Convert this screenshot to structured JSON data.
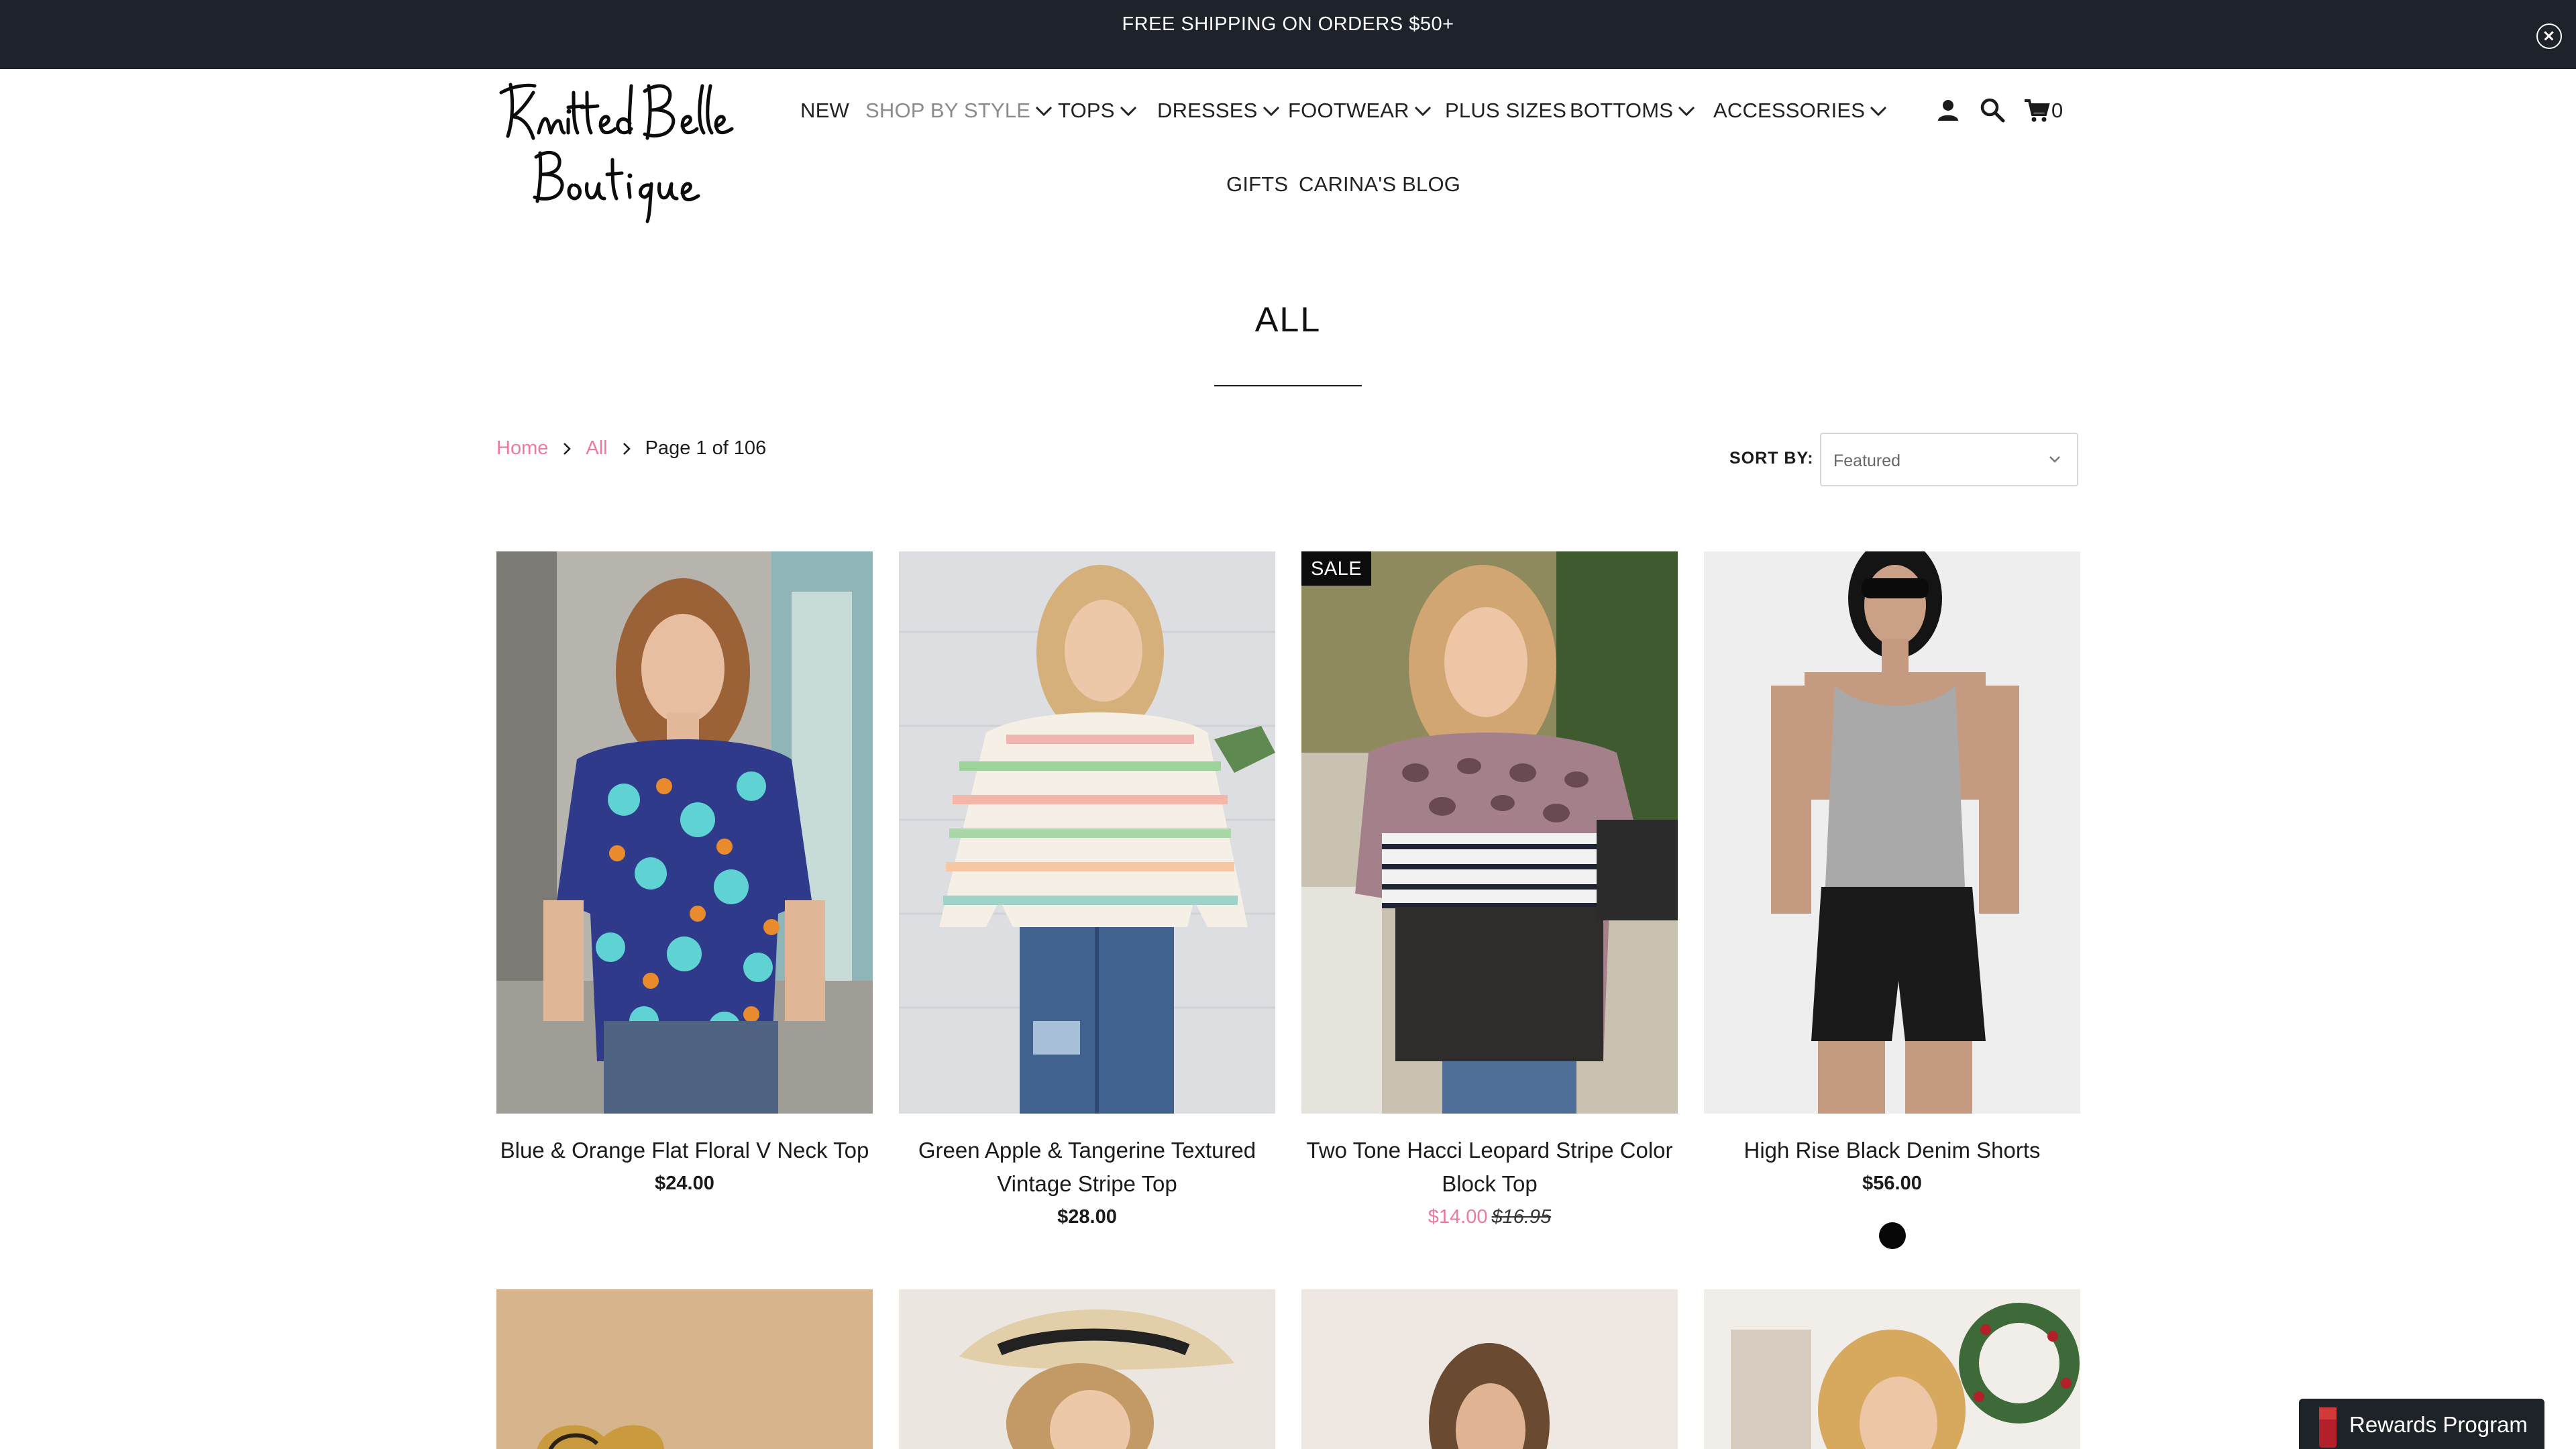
{
  "announcement": {
    "text": "FREE SHIPPING ON ORDERS $50+"
  },
  "brand": {
    "name": "Knitted Belle Boutique"
  },
  "nav": {
    "items": [
      {
        "label": "NEW",
        "has_dropdown": false
      },
      {
        "label": "SHOP BY STYLE",
        "has_dropdown": true,
        "active": true
      },
      {
        "label": "TOPS",
        "has_dropdown": true
      },
      {
        "label": "DRESSES",
        "has_dropdown": true
      },
      {
        "label": "FOOTWEAR",
        "has_dropdown": true
      },
      {
        "label": "PLUS SIZES",
        "has_dropdown": false
      },
      {
        "label": "BOTTOMS",
        "has_dropdown": true
      },
      {
        "label": "ACCESSORIES",
        "has_dropdown": true
      },
      {
        "label": "GIFTS",
        "has_dropdown": false
      },
      {
        "label": "CARINA'S BLOG",
        "has_dropdown": false
      }
    ],
    "icons": [
      "account-icon",
      "search-icon",
      "cart-icon"
    ],
    "cart_count": "0"
  },
  "page": {
    "title": "ALL"
  },
  "breadcrumb": {
    "home": "Home",
    "collection": "All",
    "current": "Page 1 of 106"
  },
  "sort": {
    "label": "SORT BY:",
    "value": "Featured"
  },
  "products": [
    {
      "title": "Blue & Orange Flat Floral V Neck Top",
      "price": "$24.00"
    },
    {
      "title": "Green Apple & Tangerine Textured Vintage Stripe Top",
      "price": "$28.00"
    },
    {
      "title": "Two Tone Hacci Leopard Stripe Color Block Top",
      "badge": "SALE",
      "sale_price": "$14.00",
      "compare_price": "$16.95"
    },
    {
      "title": "High Rise Black Denim Shorts",
      "price": "$56.00",
      "swatch_color": "#070707"
    }
  ],
  "rewards": {
    "label": "Rewards Program"
  },
  "colors": {
    "accent_pink": "#ec7aa0",
    "announcement_bg": "#1d222b",
    "rewards_bg": "#1e2229"
  }
}
